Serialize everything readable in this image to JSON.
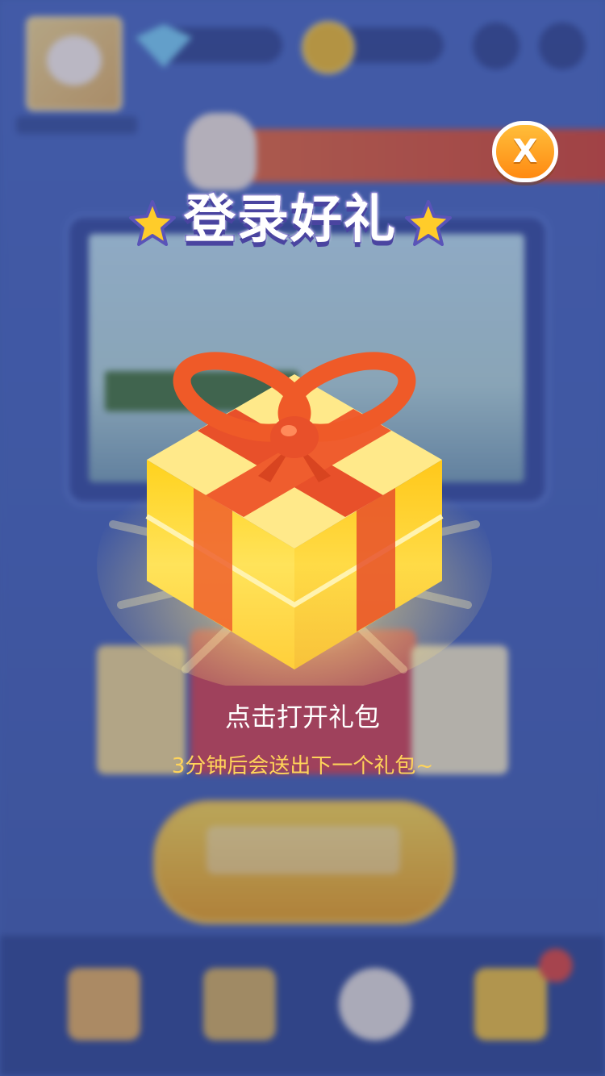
{
  "modal": {
    "title": "登录好礼",
    "close_label": "X",
    "gift_caption": "点击打开礼包",
    "gift_note": "3分钟后会送出下一个礼包~"
  },
  "icons": {
    "close": "close-icon",
    "title_star": "star-icon",
    "gift": "gift-box-icon"
  },
  "colors": {
    "background": "#4a67b4",
    "close_button": "#ff9a1e",
    "title_outline": "#5a54b8",
    "note_text": "#ffd45a",
    "gift_yellow": "#ffd62e",
    "gift_ribbon": "#e8502a"
  }
}
